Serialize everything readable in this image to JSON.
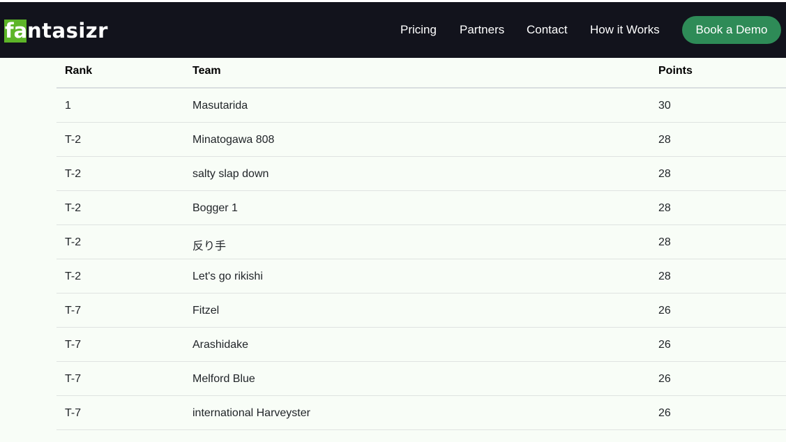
{
  "header": {
    "logo": {
      "mark": "fa",
      "rest": "ntasizr"
    },
    "nav": [
      {
        "label": "Pricing"
      },
      {
        "label": "Partners"
      },
      {
        "label": "Contact"
      },
      {
        "label": "How it Works"
      }
    ],
    "cta_label": "Book a Demo"
  },
  "colors": {
    "navbar_bg": "#12131c",
    "logo_accent": "#5db528",
    "cta_bg": "#2e8b57",
    "page_bg": "#f8fdf7"
  },
  "table": {
    "columns": [
      "Rank",
      "Team",
      "Points"
    ],
    "rows": [
      {
        "rank": "1",
        "team": "Masutarida",
        "points": "30"
      },
      {
        "rank": "T-2",
        "team": "Minatogawa 808",
        "points": "28"
      },
      {
        "rank": "T-2",
        "team": "salty slap down",
        "points": "28"
      },
      {
        "rank": "T-2",
        "team": "Bogger 1",
        "points": "28"
      },
      {
        "rank": "T-2",
        "team": "反り手",
        "points": "28"
      },
      {
        "rank": "T-2",
        "team": "Let's go rikishi",
        "points": "28"
      },
      {
        "rank": "T-7",
        "team": "Fitzel",
        "points": "26"
      },
      {
        "rank": "T-7",
        "team": "Arashidake",
        "points": "26"
      },
      {
        "rank": "T-7",
        "team": "Melford Blue",
        "points": "26"
      },
      {
        "rank": "T-7",
        "team": "international Harveyster",
        "points": "26"
      }
    ]
  }
}
